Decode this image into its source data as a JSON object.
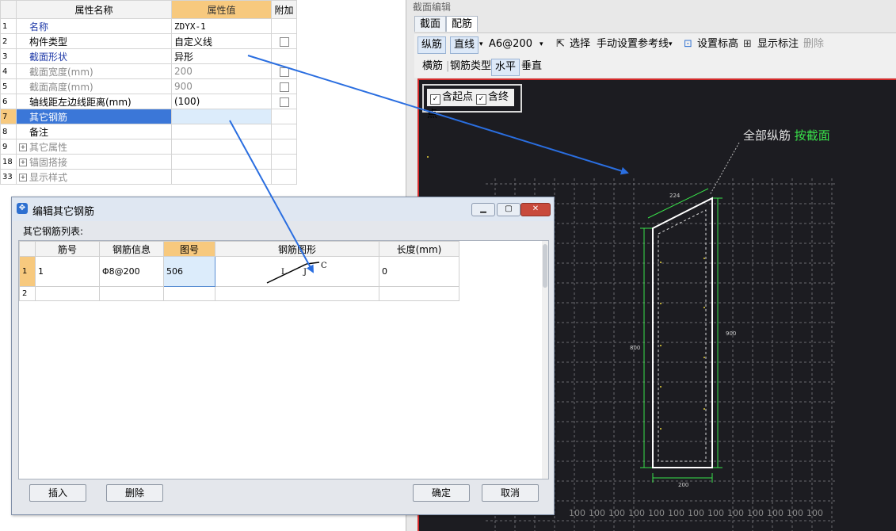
{
  "property_grid": {
    "headers": {
      "name": "属性名称",
      "value": "属性值",
      "extra": "附加"
    },
    "rows": [
      {
        "num": "1",
        "name": "名称",
        "value": "ZDYX-1",
        "checkbox": false
      },
      {
        "num": "2",
        "name": "构件类型",
        "value": "自定义线",
        "checkbox": true
      },
      {
        "num": "3",
        "name": "截面形状",
        "value": "异形",
        "checkbox": false
      },
      {
        "num": "4",
        "name": "截面宽度(mm)",
        "value": "200",
        "checkbox": true
      },
      {
        "num": "5",
        "name": "截面高度(mm)",
        "value": "900",
        "checkbox": true
      },
      {
        "num": "6",
        "name": "轴线距左边线距离(mm)",
        "value": "(100)",
        "checkbox": true
      },
      {
        "num": "7",
        "name": "其它钢筋",
        "value": "",
        "checkbox": false
      },
      {
        "num": "8",
        "name": "备注",
        "value": "",
        "checkbox": false
      },
      {
        "num": "9",
        "name": "其它属性",
        "value": "",
        "checkbox": false
      },
      {
        "num": "18",
        "name": "锚固搭接",
        "value": "",
        "checkbox": false
      },
      {
        "num": "33",
        "name": "显示样式",
        "value": "",
        "checkbox": false
      }
    ]
  },
  "section_editor": {
    "title": "截面编辑",
    "tabs": [
      "截面",
      "配筋"
    ],
    "toolbar": {
      "longitudinal": "纵筋",
      "straight_line": "直线",
      "rebar_spec": "A6@200",
      "select": "选择",
      "manual_ref": "手动设置参考线",
      "set_elevation": "设置标高",
      "show_labels": "显示标注",
      "delete": "删除",
      "stirrup": "横筋",
      "rebar_type_label": "钢筋类型:",
      "horizontal": "水平",
      "vertical": "垂直"
    },
    "options": {
      "include_start": "含起点",
      "include_end": "含终点"
    },
    "canvas_note": {
      "prefix": "全部纵筋 ",
      "highlight": "按截面"
    },
    "dims": {
      "top": "224",
      "left": "800",
      "right": "900",
      "bottom": "200",
      "grid": "100"
    }
  },
  "dialog": {
    "title": "编辑其它钢筋",
    "list_label": "其它钢筋列表:",
    "columns": [
      "筋号",
      "钢筋信息",
      "图号",
      "钢筋图形",
      "长度(mm)"
    ],
    "rows": [
      {
        "num": "1",
        "bar_no": "1",
        "info": "Φ8@200",
        "shape_no": "506",
        "length": "0"
      },
      {
        "num": "2",
        "bar_no": "",
        "info": "",
        "shape_no": "",
        "length": ""
      }
    ],
    "shape_letters": {
      "l": "L",
      "j": "J",
      "c": "C"
    },
    "buttons": {
      "insert": "插入",
      "delete": "删除",
      "ok": "确定",
      "cancel": "取消"
    }
  },
  "colors": {
    "accent_orange": "#f7c97e",
    "selection_blue": "#3b77d8",
    "canvas_bg": "#1c1c21",
    "dim_green": "#39e24a",
    "arrow_blue": "#2a6ee0"
  }
}
